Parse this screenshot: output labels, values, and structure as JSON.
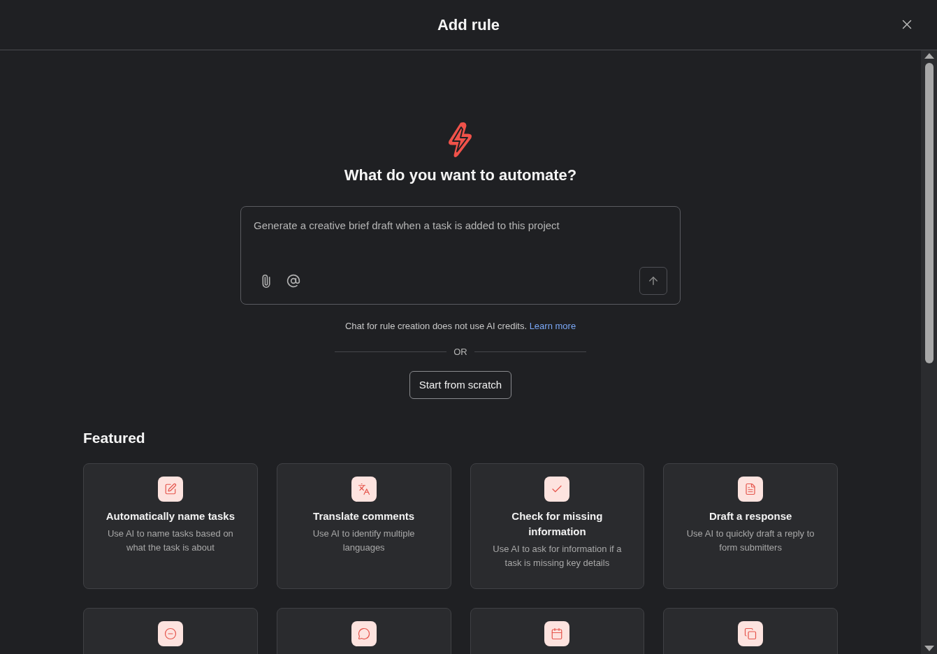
{
  "window": {
    "title": "Add rule"
  },
  "hero": {
    "heading": "What do you want to automate?"
  },
  "prompt": {
    "placeholder": "Generate a creative brief draft when a task is added to this project"
  },
  "note": {
    "text": "Chat for rule creation does not use AI credits.",
    "link": "Learn more"
  },
  "divider": {
    "label": "OR"
  },
  "scratch_button": {
    "label": "Start from scratch"
  },
  "featured": {
    "title": "Featured",
    "cards": [
      {
        "kind": "full",
        "title": "Automatically name tasks",
        "description": "Use AI to name tasks based on what the task is about"
      },
      {
        "kind": "full",
        "title": "Translate comments",
        "description": "Use AI to identify multiple languages"
      },
      {
        "kind": "full",
        "title": "Check for missing information",
        "description": "Use AI to ask for information if a task is missing key details"
      },
      {
        "kind": "full",
        "title": "Draft a response",
        "description": "Use AI to quickly draft a reply to form submitters"
      },
      {
        "kind": "cut_off"
      },
      {
        "kind": "cut_off"
      },
      {
        "kind": "cut_off"
      },
      {
        "kind": "cut_off"
      }
    ]
  }
}
